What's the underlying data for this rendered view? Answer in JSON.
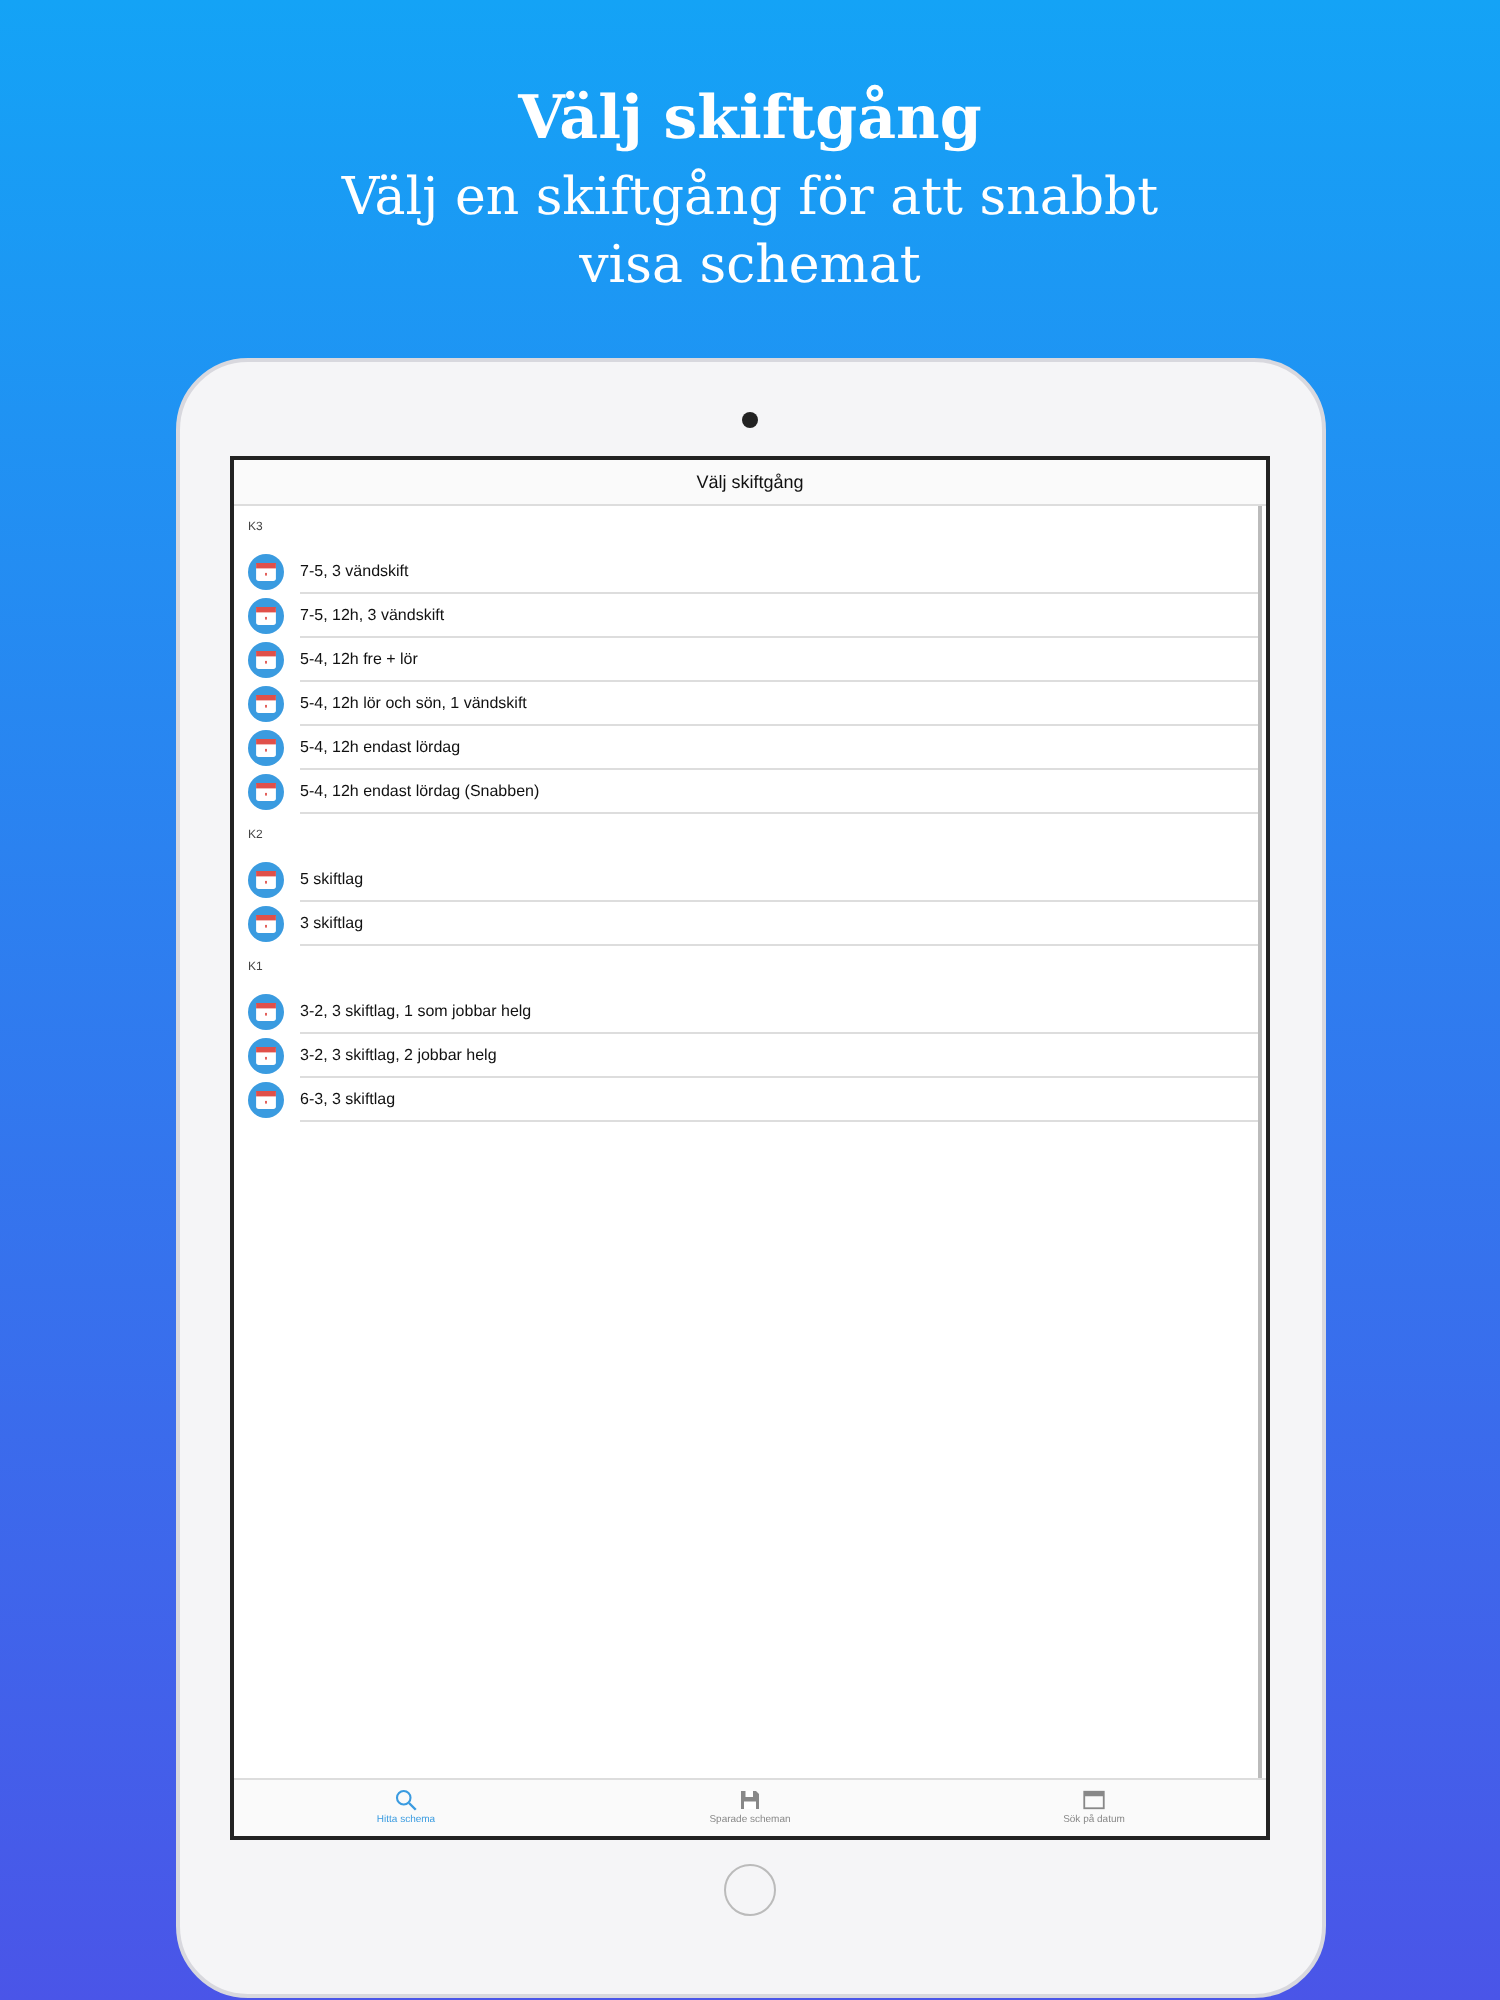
{
  "headline": "Välj skiftgång",
  "subtitle": "Välj en skiftgång för att snabbt visa schemat",
  "nav_title": "Välj skiftgång",
  "sections": [
    {
      "header": "K3",
      "items": [
        "7-5, 3 vändskift",
        "7-5, 12h, 3 vändskift",
        "5-4, 12h fre + lör",
        "5-4, 12h lör och sön, 1 vändskift",
        "5-4, 12h endast lördag",
        "5-4, 12h endast lördag (Snabben)"
      ]
    },
    {
      "header": "K2",
      "items": [
        "5 skiftlag",
        "3 skiftlag"
      ]
    },
    {
      "header": "K1",
      "items": [
        "3-2, 3 skiftlag, 1 som jobbar helg",
        "3-2, 3 skiftlag, 2 jobbar helg",
        "6-3, 3 skiftlag"
      ]
    }
  ],
  "tabs": [
    {
      "label": "Hitta schema",
      "kind": "search",
      "selected": true
    },
    {
      "label": "Sparade scheman",
      "kind": "save",
      "selected": false
    },
    {
      "label": "Sök på datum",
      "kind": "calendar",
      "selected": false
    }
  ]
}
